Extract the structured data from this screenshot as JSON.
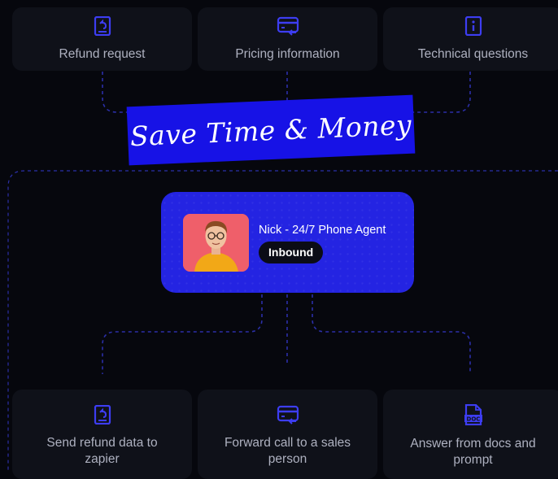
{
  "top_cards": [
    {
      "label": "Refund request",
      "icon": "refund-receipt-icon"
    },
    {
      "label": "Pricing information",
      "icon": "credit-card-icon"
    },
    {
      "label": "Technical questions",
      "icon": "info-document-icon"
    }
  ],
  "banner": {
    "text": "Save Time & Money"
  },
  "agent": {
    "name": "Nick - 24/7 Phone Agent",
    "badge": "Inbound",
    "avatar": "agent-avatar"
  },
  "bottom_cards": [
    {
      "label": "Send refund data to zapier",
      "icon": "refund-receipt-icon"
    },
    {
      "label": "Forward call to a sales person",
      "icon": "credit-card-icon"
    },
    {
      "label": "Answer from docs and prompt",
      "icon": "doc-file-icon"
    }
  ],
  "colors": {
    "background": "#06070d",
    "card": "#0f1119",
    "accent_blue": "#2424e2",
    "banner_blue": "#1712e6",
    "icon_blue": "#3d3df2",
    "connector": "#2b2fa8"
  }
}
